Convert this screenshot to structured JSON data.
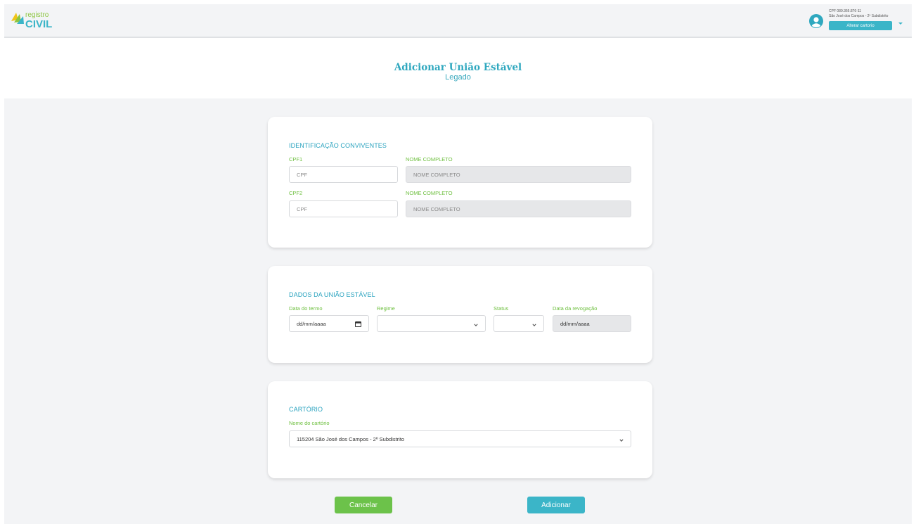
{
  "header": {
    "logo_text": "registro CIVIL",
    "user": {
      "cpf": "CPF 089.366.876-11",
      "cartorio": "São José dos Campos - 2º Subdistrito",
      "change_button": "Alterar cartorio"
    }
  },
  "page": {
    "title": "Adicionar União Estável",
    "subtitle": "Legado"
  },
  "identificacao": {
    "section_title": "IDENTIFICAÇÃO CONVIVENTES",
    "cpf1_label": "CPF1",
    "cpf1_placeholder": "CPF",
    "nome1_label": "NOME COMPLETO",
    "nome1_placeholder": "NOME COMPLETO",
    "cpf2_label": "CPF2",
    "cpf2_placeholder": "CPF",
    "nome2_label": "NOME COMPLETO",
    "nome2_placeholder": "NOME COMPLETO"
  },
  "dados": {
    "section_title": "DADOS DA UNIÃO ESTÁVEL",
    "data_termo_label": "Data do termo",
    "data_termo_value": "dd/mm/aaaa",
    "regime_label": "Regime",
    "regime_value": "",
    "status_label": "Status",
    "status_value": "",
    "data_revogacao_label": "Data da revogação",
    "data_revogacao_value": "dd/mm/aaaa"
  },
  "cartorio": {
    "section_title": "CARTÓRIO",
    "nome_label": "Nome do cartório",
    "nome_value": "115204 São José dos Campos - 2º Subdistrito"
  },
  "actions": {
    "cancel_label": "Cancelar",
    "add_label": "Adicionar"
  },
  "colors": {
    "primary_teal": "#3bb5c8",
    "label_green": "#6dbf3e",
    "cancel_green": "#6cc24a",
    "title_teal": "#2fa8bf"
  },
  "icons": [
    "user-avatar-icon",
    "chevron-down-icon",
    "calendar-icon"
  ]
}
